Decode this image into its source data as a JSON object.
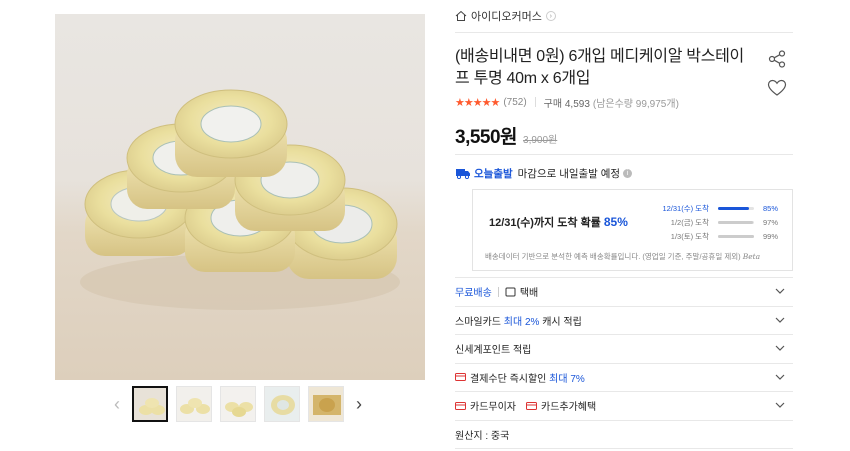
{
  "store": {
    "name": "아이디오커머스"
  },
  "product": {
    "title": "(배송비내면 0원) 6개입 메디케이알 박스테이프 투명 40m x 6개입",
    "stars": "★★★★★",
    "review_count": "(752)",
    "purchase_label": "구매 4,593",
    "stock": "(남은수량 99,975개)",
    "price": "3,550원",
    "original_price": "3,900원"
  },
  "shipping": {
    "badge": "오늘출발",
    "text": "마감으로 내일출발 예정",
    "info": "i",
    "headline_prefix": "12/31(수)까지 도착 확률",
    "headline_pct": "85%",
    "rows": [
      {
        "date": "12/31(수) 도착",
        "value": "85%",
        "fraction": 0.85
      },
      {
        "date": "1/2(금) 도착",
        "value": "97%",
        "fraction": 0.97
      },
      {
        "date": "1/3(토) 도착",
        "value": "99%",
        "fraction": 0.99
      }
    ],
    "note": "배송데이터 기반으로 분석한 예측 배송확률입니다. (영업일 기준, 주말/공휴일 제외)",
    "beta": "Beta"
  },
  "options": {
    "free_shipping": "무료배송",
    "courier": "택배",
    "smile_prefix": "스마일카드",
    "smile_max": "최대 2%",
    "smile_suffix": "캐시 적립",
    "shinsegae": "신세계포인트 적립",
    "payment_prefix": "결제수단 즉시할인",
    "payment_max": "최대 7%",
    "card_interest": "카드무이자",
    "card_benefit": "카드추가혜택",
    "origin": "원산지 : 중국"
  },
  "thumbnails": {
    "count": 5,
    "active_index": 0
  },
  "colors": {
    "accent": "#1a56d9",
    "star": "#ff5a2e"
  },
  "icons": [
    "home-icon",
    "share-icon",
    "heart-icon",
    "truck-icon",
    "chevron-down-icon",
    "card-icon",
    "box-icon"
  ]
}
